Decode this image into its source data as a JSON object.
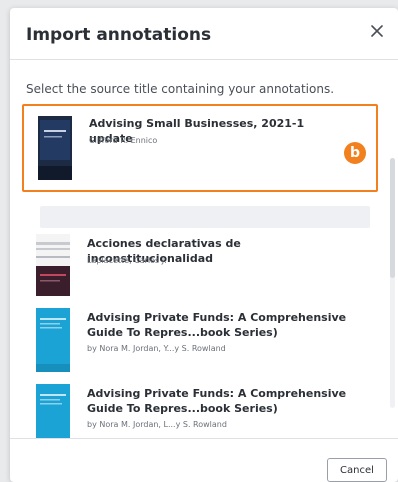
{
  "dialog": {
    "title": "Import annotations",
    "close_icon": "close-icon",
    "instruction": "Select the source title containing your annotations.",
    "cancel_label": "Cancel"
  },
  "marker": {
    "label": "b",
    "color": "#f3801e"
  },
  "books": [
    {
      "title": "Advising Small Businesses, 2021-1 update",
      "author": "Clifford R. Ennico",
      "selected": true,
      "cover_color": "#1f2f4a"
    },
    {
      "title": "Acciones declarativas de inconstitucionalidad",
      "author": "Laplacette, Carlos J.",
      "selected": false,
      "cover_color": "#3a1e2c"
    },
    {
      "title": "Advising Private Funds: A Comprehensive Guide To Repres...book Series)",
      "author": "by Nora M. Jordan, Y...y S. Rowland",
      "selected": false,
      "cover_color": "#1aa3d4"
    },
    {
      "title": "Advising Private Funds: A Comprehensive Guide To Repres...book Series)",
      "author": "by Nora M. Jordan, L...y S. Rowland",
      "selected": false,
      "cover_color": "#1aa3d4"
    }
  ],
  "colors": {
    "accent": "#f3801e",
    "text": "#2b2f36",
    "muted": "#6b7079"
  }
}
